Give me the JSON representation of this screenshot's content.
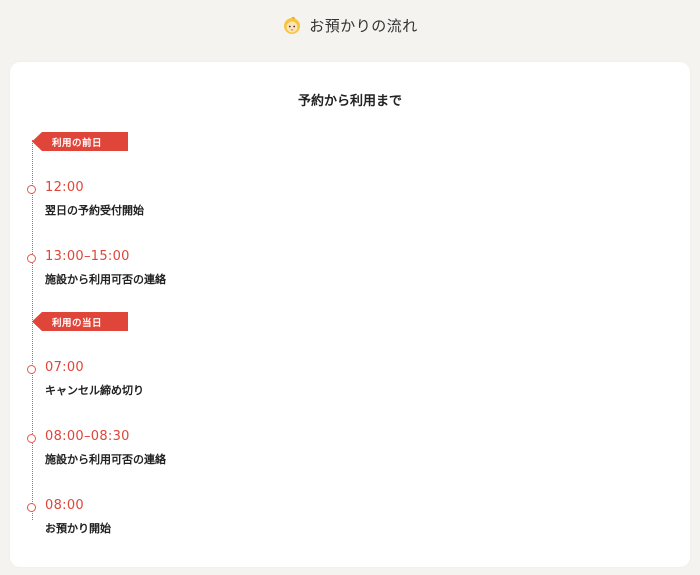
{
  "header": {
    "title": "お預かりの流れ",
    "icon": "baby-icon"
  },
  "card": {
    "title": "予約から利用まで"
  },
  "colors": {
    "accent": "#e0453a",
    "background": "#f4f3ef",
    "card": "#ffffff"
  },
  "timeline": {
    "day_before_label": "利用の前日",
    "day_of_label": "利用の当日",
    "events": [
      {
        "time": "12:00",
        "desc": "翌日の予約受付開始"
      },
      {
        "time": "13:00–15:00",
        "desc": "施設から利用可否の連絡"
      },
      {
        "time": "07:00",
        "desc": "キャンセル締め切り"
      },
      {
        "time": "08:00–08:30",
        "desc": "施設から利用可否の連絡"
      },
      {
        "time": "08:00",
        "desc": "お預かり開始"
      }
    ]
  }
}
